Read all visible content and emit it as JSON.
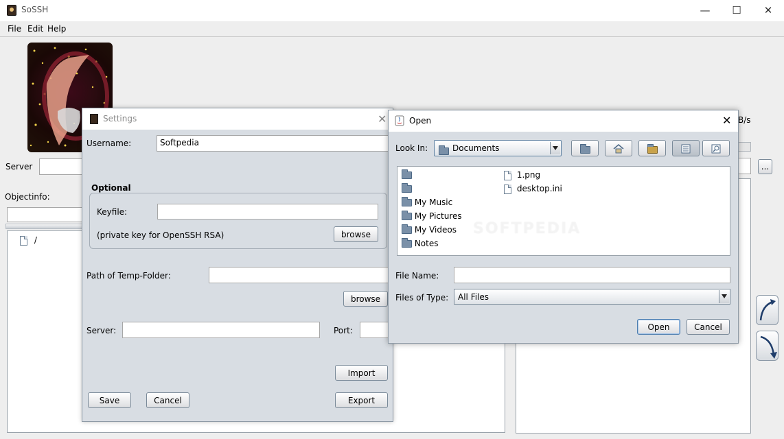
{
  "window": {
    "title": "SoSSH",
    "min": "—",
    "max": "☐",
    "close": "✕"
  },
  "menu": [
    "File",
    "Edit",
    "Help"
  ],
  "main": {
    "server_label": "Server",
    "objectinfo_label": "Objectinfo:",
    "tree_item": "/",
    "speed_label_fragment": "B/s",
    "browse_small": "..."
  },
  "settings": {
    "title": "Settings",
    "username_label": "Username:",
    "username_value": "Softpedia",
    "optional_label": "Optional",
    "keyfile_label": "Keyfile:",
    "keyfile_value": "",
    "private_key_note": "(private key for OpenSSH RSA)",
    "browse_keyfile": "browse",
    "temp_label": "Path of Temp-Folder:",
    "temp_value": "",
    "browse_temp": "browse",
    "server_label": "Server:",
    "server_value": "",
    "port_label": "Port:",
    "port_value": "",
    "import_label": "Import",
    "save_label": "Save",
    "cancel_label": "Cancel",
    "export_label": "Export"
  },
  "open_dialog": {
    "title": "Open",
    "look_in_label": "Look In:",
    "look_in_value": "Documents",
    "folders": [
      "",
      "",
      "My Music",
      "My Pictures",
      "My Videos",
      "Notes"
    ],
    "files": [
      "1.png",
      "desktop.ini"
    ],
    "file_name_label": "File Name:",
    "file_name_value": "",
    "files_type_label": "Files of Type:",
    "files_type_value": "All Files",
    "open_label": "Open",
    "cancel_label": "Cancel"
  },
  "watermark": "SOFTPEDIA"
}
